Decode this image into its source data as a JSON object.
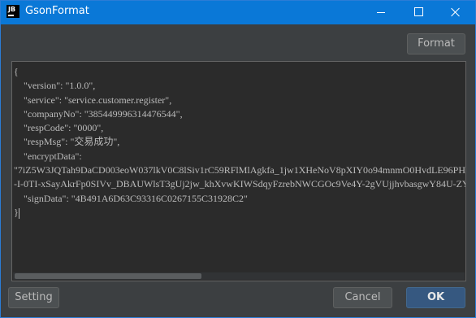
{
  "window": {
    "logo_text": "JB",
    "title": "GsonFormat"
  },
  "toolbar": {
    "format_label": "Format"
  },
  "editor": {
    "lines": [
      "{",
      "    \"version\": \"1.0.0\",",
      "    \"service\": \"service.customer.register\",",
      "    \"companyNo\": \"385449996314476544\",",
      "    \"respCode\": \"0000\",",
      "    \"respMsg\": \"交易成功\",",
      "    \"encryptData\":",
      "\"7iZ5W3JQTah9DaCD003eoW037lkV0C8lSiv1rC59RFlMlAgkfa_1jw1XHeNoV8pXIY0o94mnmO0HvdLE96PH",
      "-I-0TI-xSayAkrFp0SIVv_DBAUWlsT3gUj2jw_khXvwKIWSdqyFzrebNWCGOc9Ve4Y-2gVUjjhvbasgwY84U-ZY",
      "    \"signData\": \"4B491A6D63C93316C0267155C31928C2\"",
      "}"
    ]
  },
  "footer": {
    "setting_label": "Setting",
    "cancel_label": "Cancel",
    "ok_label": "OK"
  }
}
